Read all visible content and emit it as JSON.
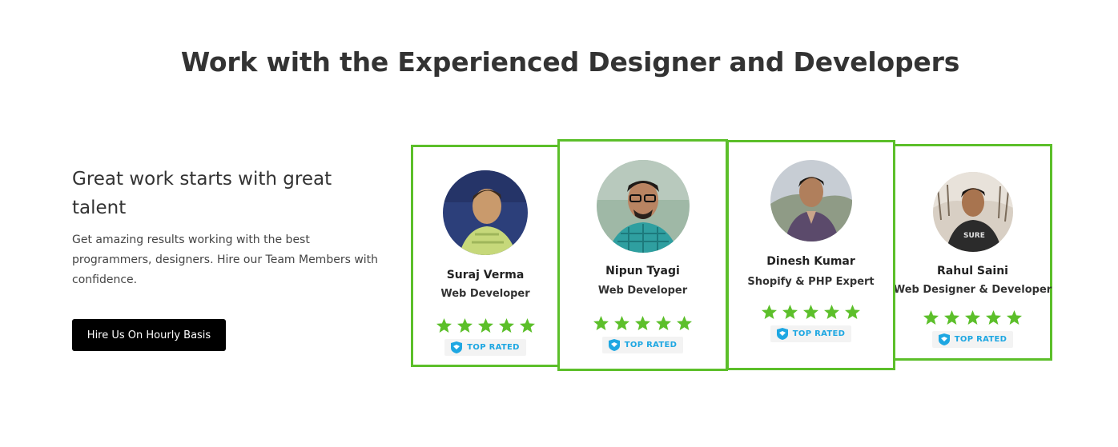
{
  "section": {
    "heading": "Work with the Experienced Designer and Developers"
  },
  "intro": {
    "subheading": "Great work starts with great talent",
    "description": "Get amazing results working with the best programmers, designers. Hire our Team Members with confidence.",
    "cta_label": "Hire Us On Hourly Basis"
  },
  "colors": {
    "card_border": "#5cbf2a",
    "star": "#5cbf2a",
    "badge_text": "#1ea7e2",
    "button_bg": "#000000"
  },
  "team": [
    {
      "name": "Suraj Verma",
      "role": "Web Developer",
      "rating": 5,
      "badge": "TOP RATED",
      "avatar_icon": "person-photo"
    },
    {
      "name": "Nipun Tyagi",
      "role": "Web Developer",
      "rating": 5,
      "badge": "TOP RATED",
      "avatar_icon": "person-photo"
    },
    {
      "name": "Dinesh Kumar",
      "role": "Shopify & PHP Expert",
      "rating": 5,
      "badge": "TOP RATED",
      "avatar_icon": "person-photo"
    },
    {
      "name": "Rahul Saini",
      "role": "Web Designer & Developer",
      "rating": 5,
      "badge": "TOP RATED",
      "avatar_icon": "person-photo"
    }
  ]
}
